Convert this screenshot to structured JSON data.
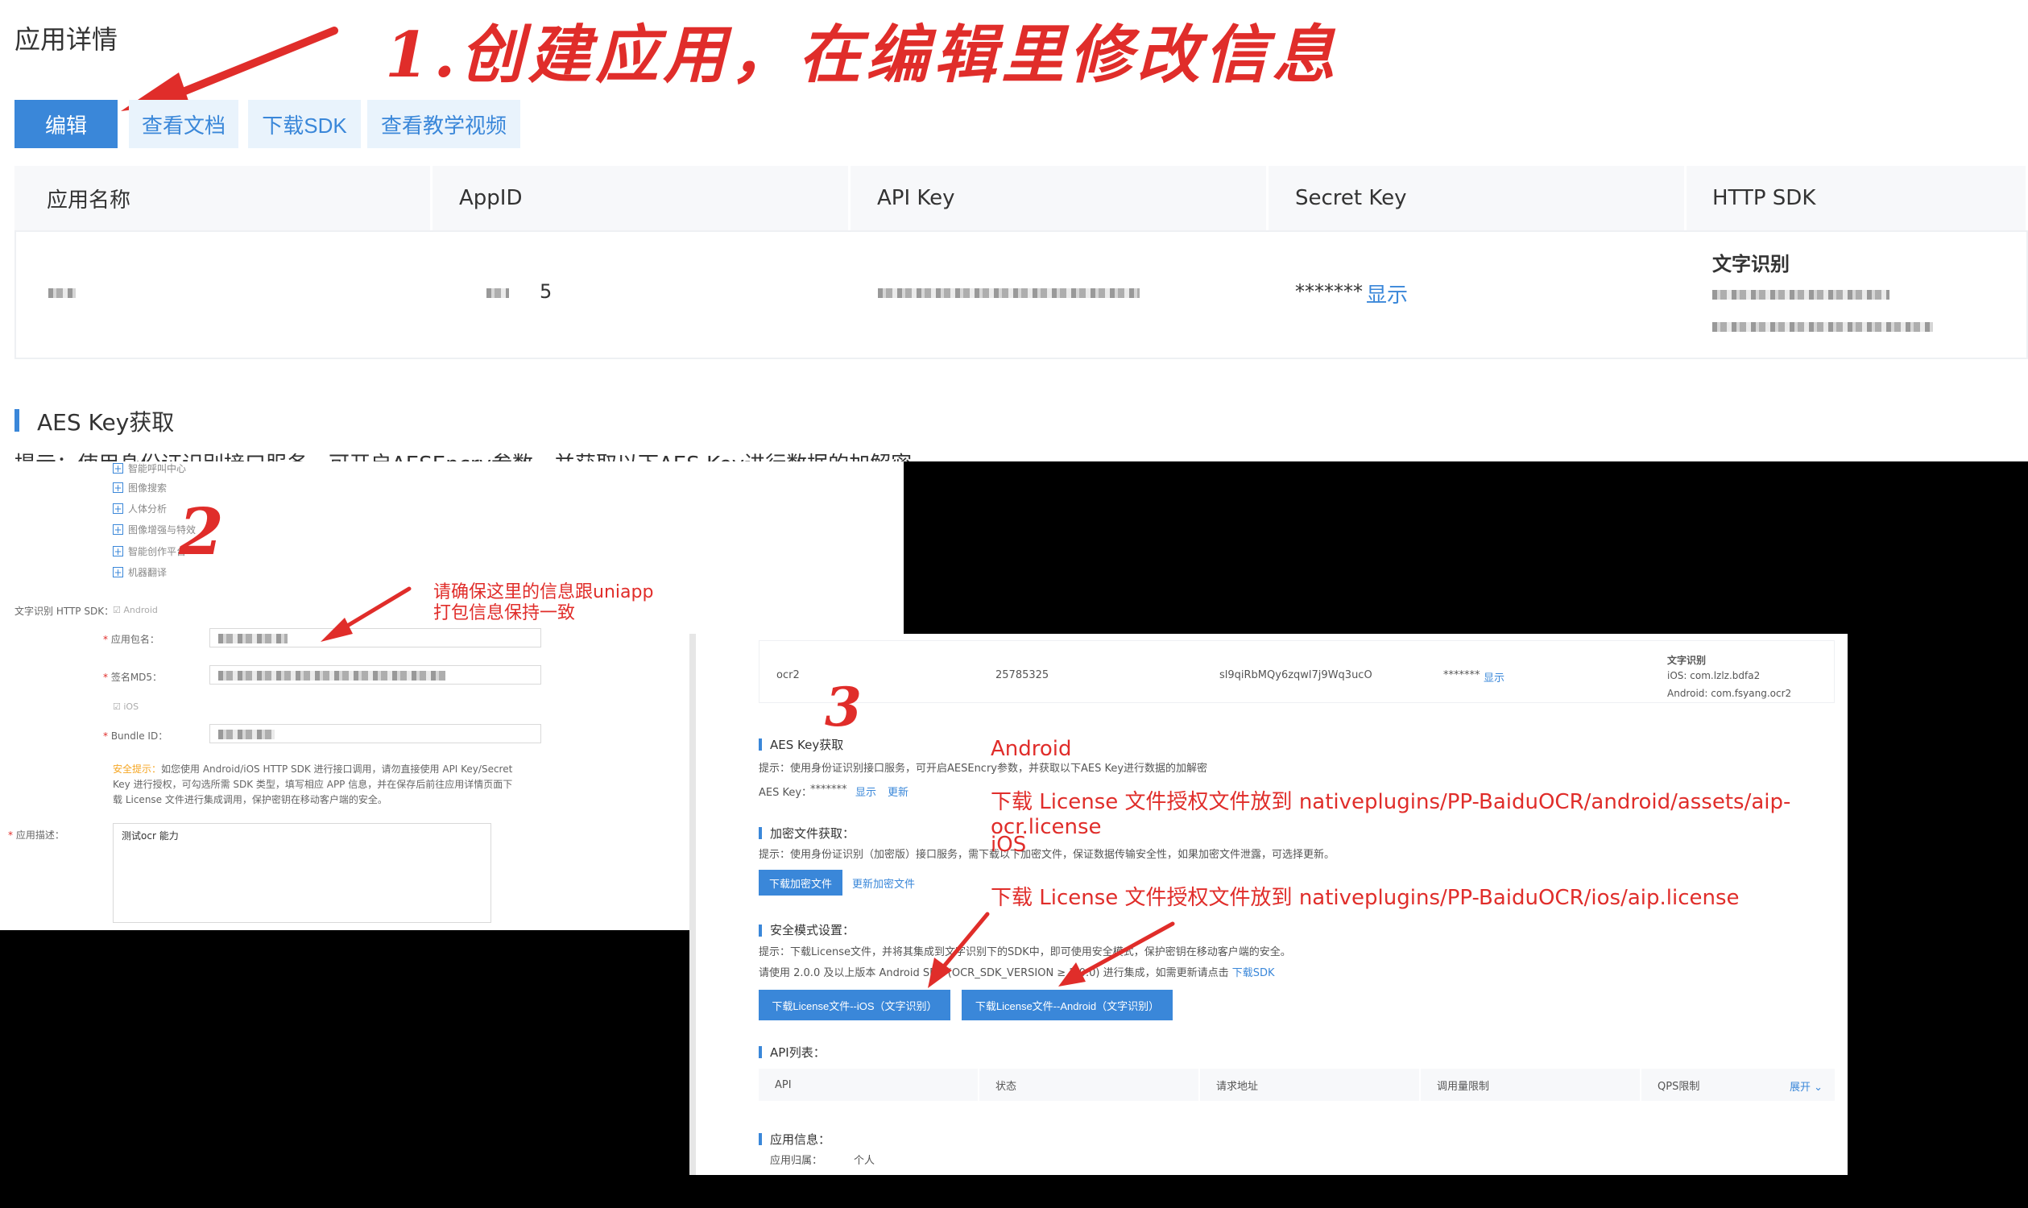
{
  "top": {
    "page_title": "应用详情",
    "annotation": "1.创建应用，在编辑里修改信息",
    "toolbar": {
      "edit": "编辑",
      "docs": "查看文档",
      "download_sdk": "下载SDK",
      "tutorial_video": "查看教学视频"
    },
    "table": {
      "headers": [
        "应用名称",
        "AppID",
        "API Key",
        "Secret Key",
        "HTTP SDK"
      ],
      "appid_tail": "5",
      "secret_masked": "*******",
      "show_link": "显示",
      "sdk_title": "文字识别"
    },
    "aes_section": {
      "title": "AES Key获取",
      "hint": "提示：使用身份证识别接口服务，可开启AESEncry参数，并获取以下AES Key进行数据的加解密"
    }
  },
  "panel2": {
    "annotation_number": "2",
    "tree": [
      "智能呼叫中心",
      "图像搜索",
      "人体分析",
      "图像增强与特效",
      "智能创作平台",
      "机器翻译"
    ],
    "http_sdk_label": "文字识别 HTTP SDK：",
    "android": "Android",
    "package_label": "应用包名：",
    "md5_label": "签名MD5：",
    "ios": "iOS",
    "bundle_label": "Bundle ID：",
    "note_prefix": "安全提示：",
    "note": "如您使用 Android/iOS HTTP SDK 进行接口调用，请勿直接使用 API Key/Secret Key 进行授权，可勾选所需 SDK 类型，填写相应 APP 信息，并在保存后前往应用详情页面下载 License 文件进行集成调用，保护密钥在移动客户端的安全。",
    "desc_label": "应用描述：",
    "desc_value": "测试ocr 能力",
    "annotation": [
      "请确保这里的信息跟uniapp",
      "打包信息保持一致"
    ]
  },
  "panel3": {
    "annotation_number": "3",
    "row": {
      "name": "ocr2",
      "appid": "25785325",
      "api_key": "sl9qiRbMQy6zqwl7j9Wq3ucO",
      "secret": "*******",
      "show": "显示",
      "sdk_title": "文字识别",
      "sdk_ios": "iOS: com.lzlz.bdfa2",
      "sdk_android": "Android: com.fsyang.ocr2"
    },
    "aes": {
      "title": "AES Key获取",
      "hint": "提示：使用身份证识别接口服务，可开启AESEncry参数，并获取以下AES Key进行数据的加解密",
      "key_label": "AES Key：",
      "key_value": "*******",
      "show": "显示",
      "update": "更新"
    },
    "encrypt": {
      "title": "加密文件获取：",
      "hint": "提示：使用身份证识别（加密版）接口服务，需下载以下加密文件，保证数据传输安全性，如果加密文件泄露，可选择更新。",
      "download": "下载加密文件",
      "update": "更新加密文件"
    },
    "security": {
      "title": "安全模式设置：",
      "hint": "提示：下载License文件，并将其集成到文字识别下的SDK中，即可使用安全模式，保护密钥在移动客户端的安全。",
      "version": "请使用 2.0.0 及以上版本 Android SDK (OCR_SDK_VERSION ≥ 2.0.0) 进行集成，如需更新请点击",
      "download_sdk": "下载SDK",
      "btn_ios": "下载License文件--iOS（文字识别）",
      "btn_android": "下载License文件--Android（文字识别）"
    },
    "api_list": {
      "title": "API列表：",
      "headers": [
        "API",
        "状态",
        "请求地址",
        "调用量限制",
        "QPS限制"
      ],
      "expand": "展开"
    },
    "app_info": {
      "title": "应用信息：",
      "owner_label": "应用归属：",
      "owner_value": "个人"
    }
  },
  "annotations3": {
    "android_title": "Android",
    "android_path": "下载 License 文件授权文件放到 nativeplugins/PP-BaiduOCR/android/assets/aip-ocr.license",
    "ios_title": "iOS",
    "ios_path": "下载 License 文件授权文件放到 nativeplugins/PP-BaiduOCR/ios/aip.license"
  },
  "colors": {
    "accent": "#3a87d9",
    "annotation_red": "#e02d2a"
  }
}
